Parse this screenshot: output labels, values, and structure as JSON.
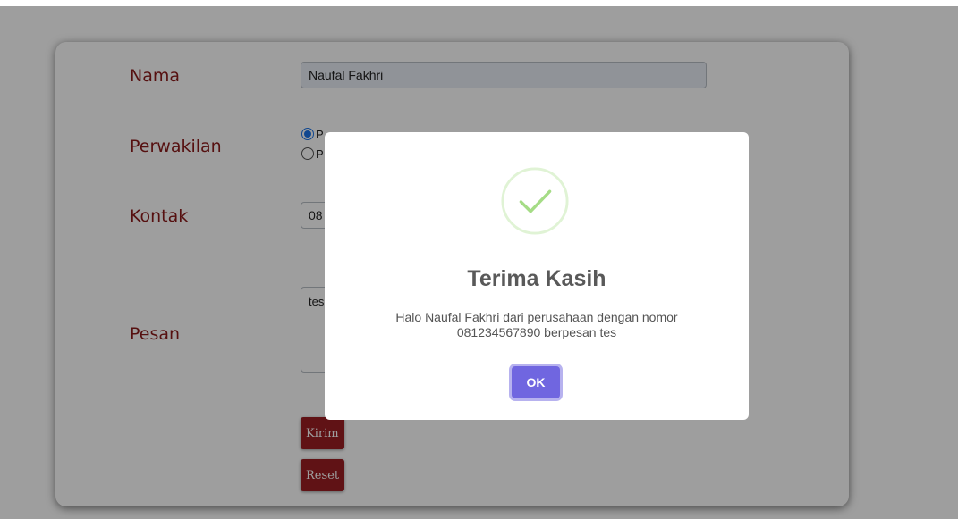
{
  "form": {
    "nama_label": "Nama",
    "nama_value": "Naufal Fakhri",
    "perwakilan_label": "Perwakilan",
    "kontak_label": "Kontak",
    "kontak_value": "08",
    "pesan_label": "Pesan",
    "pesan_value": "tes",
    "kirim_label": "Kirim",
    "reset_label": "Reset",
    "radio_options": [
      {
        "label": "P",
        "checked": true
      },
      {
        "label": "P",
        "checked": false
      }
    ]
  },
  "modal": {
    "icon": "success-check-icon",
    "title": "Terima Kasih",
    "message_line1": "Halo Naufal Fakhri dari perusahaan dengan nomor",
    "message_line2": "081234567890 berpesan tes",
    "ok_label": "OK"
  },
  "colors": {
    "label_color": "#8b1a1a",
    "button_red": "#9b1d22",
    "ok_button": "#7066e0",
    "check_green": "#a5dc86",
    "overlay": "rgba(0,0,0,0.38)"
  }
}
